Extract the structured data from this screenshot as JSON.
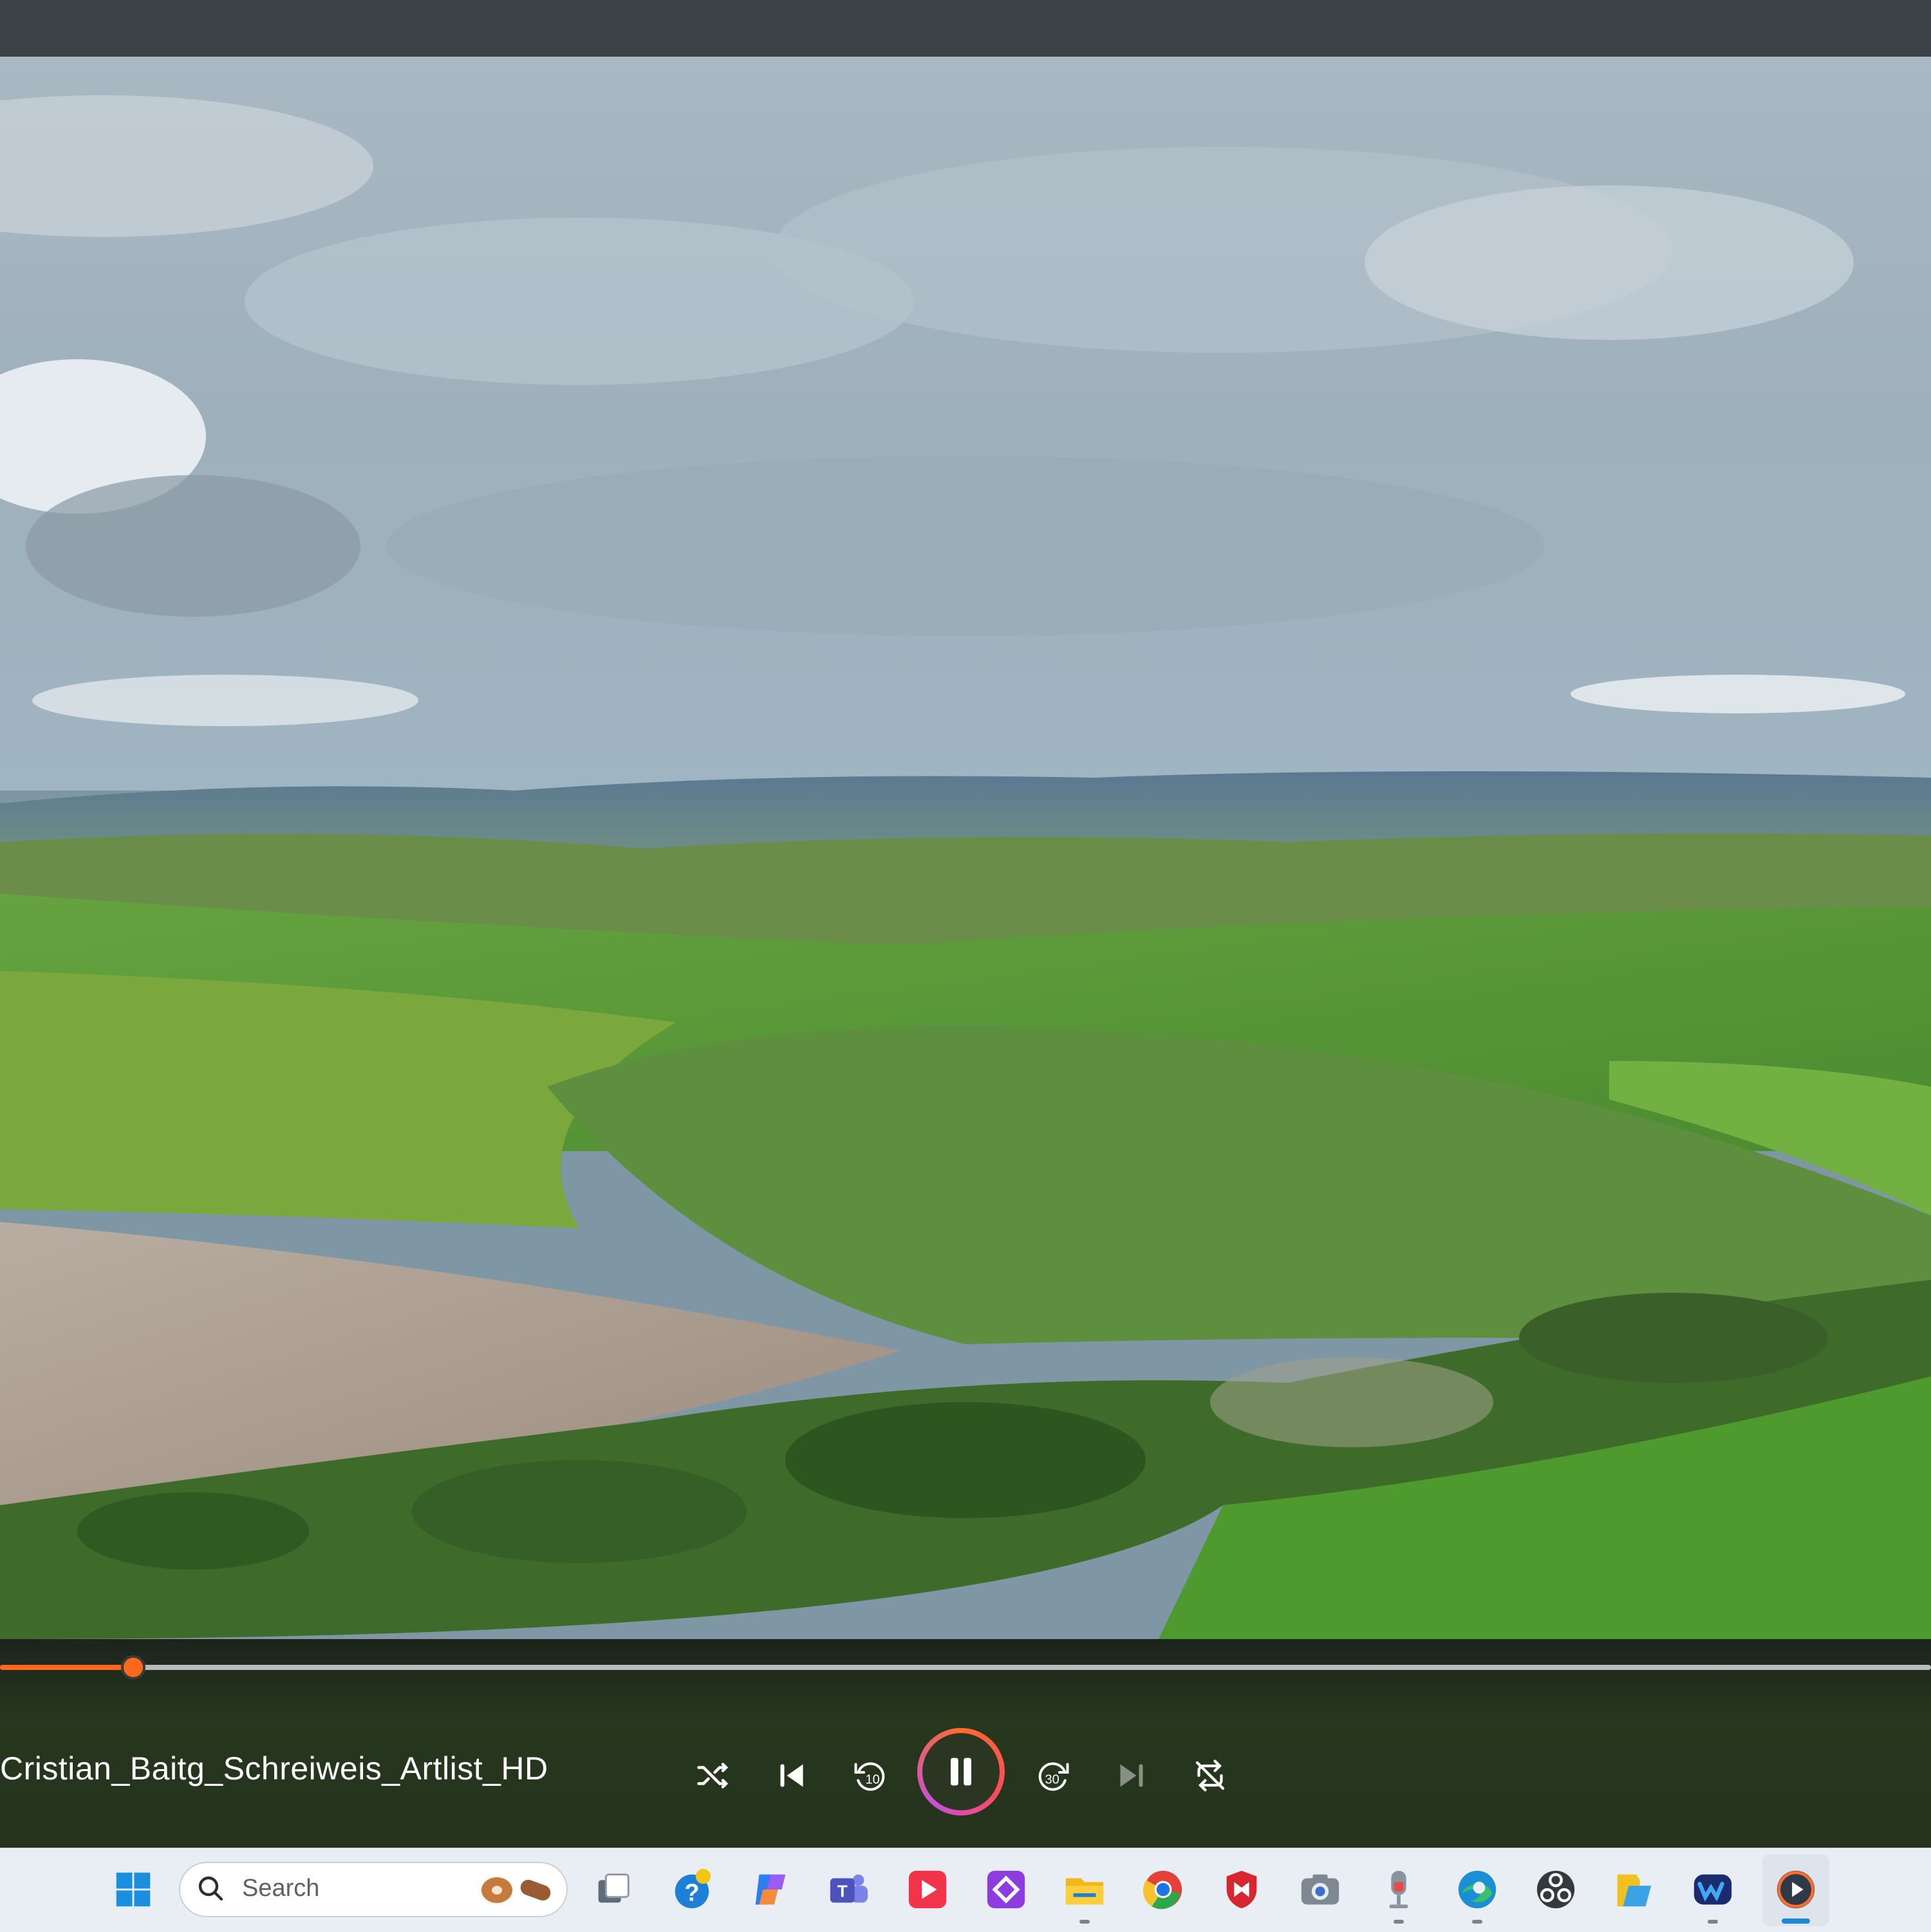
{
  "window": {
    "title_bar": ""
  },
  "media": {
    "title": "Cristian_Baitg_Schreiweis_Artlist_HD",
    "progress_fraction": 0.069,
    "state": "playing"
  },
  "controls": [
    {
      "name": "shuffle-button",
      "icon": "shuffle-icon"
    },
    {
      "name": "previous-button",
      "icon": "skip-previous-icon"
    },
    {
      "name": "rewind-10-button",
      "icon": "rewind-10-icon",
      "label": "10"
    },
    {
      "name": "pause-button",
      "icon": "pause-icon"
    },
    {
      "name": "forward-30-button",
      "icon": "forward-30-icon",
      "label": "30"
    },
    {
      "name": "next-button",
      "icon": "skip-next-icon"
    },
    {
      "name": "repeat-off-button",
      "icon": "repeat-off-icon"
    }
  ],
  "taskbar": {
    "search_placeholder": "Search",
    "apps": [
      "windows-start-icon",
      "task-view-icon",
      "help-icon",
      "copilot-icon",
      "teams-icon",
      "media-app-icon",
      "diamond-app-icon",
      "file-explorer-icon",
      "chrome-icon",
      "mcafee-icon",
      "camera-icon",
      "voice-recorder-icon",
      "edge-icon",
      "obs-icon",
      "files-icon",
      "app-icon",
      "media-player-icon"
    ]
  },
  "colors": {
    "accent": "#ff6a1a",
    "title_bar": "#3b4147",
    "taskbar": "#e9eef4",
    "active_indicator": "#1f88d6"
  }
}
